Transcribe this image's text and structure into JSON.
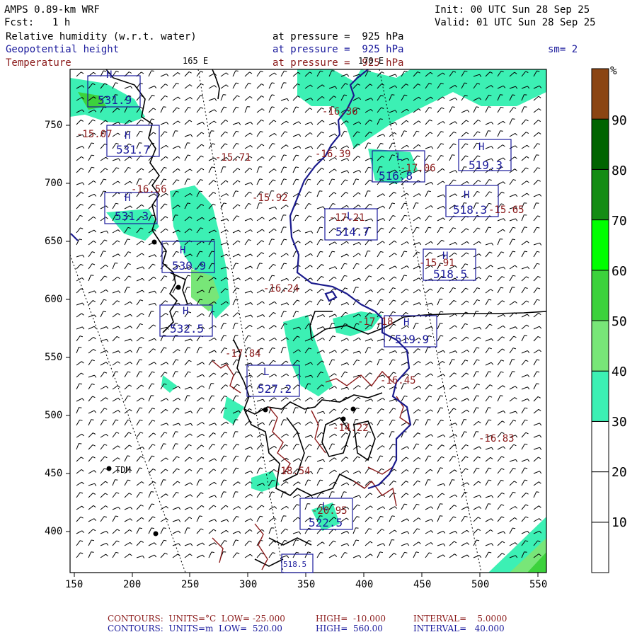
{
  "header": {
    "model": "AMPS 0.89-km WRF",
    "init": "Init: 00 UTC Sun 28 Sep 25",
    "fcst_label": "Fcst:",
    "fcst_value": "1 h",
    "valid": "Valid: 01 UTC Sun 28 Sep 25",
    "rh_label": "Relative humidity (w.r.t. water)",
    "rh_pressure": "at pressure =  925 hPa",
    "gph_label": "Geopotential height",
    "gph_pressure": "at pressure =  925 hPa",
    "temp_label": "Temperature",
    "temp_pressure": "at pressure =  925 hPa",
    "sm": "sm= 2",
    "lon_165": "165 E",
    "lon_170": "170 E"
  },
  "colorbar": {
    "unit": "%",
    "ticks": [
      "10",
      "20",
      "30",
      "40",
      "50",
      "60",
      "70",
      "80",
      "90"
    ],
    "bands": [
      {
        "color": "#ffffff"
      },
      {
        "color": "#ffffff"
      },
      {
        "color": "#ffffff"
      },
      {
        "color": "#3cf0b4"
      },
      {
        "color": "#78e678"
      },
      {
        "color": "#3cd23c"
      },
      {
        "color": "#00ff00"
      },
      {
        "color": "#148c14"
      },
      {
        "color": "#006400"
      },
      {
        "color": "#8b4513"
      }
    ]
  },
  "axes": {
    "x_ticks": [
      "150",
      "200",
      "250",
      "300",
      "350",
      "400",
      "450",
      "500",
      "550"
    ],
    "y_ticks": [
      "750",
      "700",
      "650",
      "600",
      "550",
      "500",
      "450",
      "400"
    ]
  },
  "places": {
    "tdm": "TDM"
  },
  "height_labels": [
    {
      "text": "531.9"
    },
    {
      "text": "531.7"
    },
    {
      "text": "531.3"
    },
    {
      "text": "530.9"
    },
    {
      "text": "532.5"
    },
    {
      "text": "527.2"
    },
    {
      "text": "516.8"
    },
    {
      "text": "514.7"
    },
    {
      "text": "519.3"
    },
    {
      "text": "518.5"
    },
    {
      "text": "519.9"
    },
    {
      "text": "522.5"
    },
    {
      "text": "518.3"
    },
    {
      "text": "518.5"
    }
  ],
  "temp_labels": [
    {
      "text": "-15.07"
    },
    {
      "text": "-15.71"
    },
    {
      "text": "-15.92"
    },
    {
      "text": "-16.24"
    },
    {
      "text": "-17.84"
    },
    {
      "text": "-16.36"
    },
    {
      "text": "-16.39"
    },
    {
      "text": "-17.06"
    },
    {
      "text": "-17.21"
    },
    {
      "text": "-15.91"
    },
    {
      "text": "-17.18"
    },
    {
      "text": "-16.45"
    },
    {
      "text": "-14.22"
    },
    {
      "text": "-16.83"
    },
    {
      "text": "-18.54"
    },
    {
      "text": "-20.95"
    },
    {
      "text": "-15.65"
    },
    {
      "text": "-16.56"
    }
  ],
  "footer": {
    "line1_contours": "CONTOURS:  UNITS=°C  LOW= -25.000",
    "line1_high": "HIGH=  -10.000",
    "line1_interval": "INTERVAL=    5.0000",
    "line2_contours": "CONTOURS:  UNITS=m  LOW=  520.00",
    "line2_high": "HIGH=  560.00",
    "line2_interval": "INTERVAL=   40.000"
  }
}
